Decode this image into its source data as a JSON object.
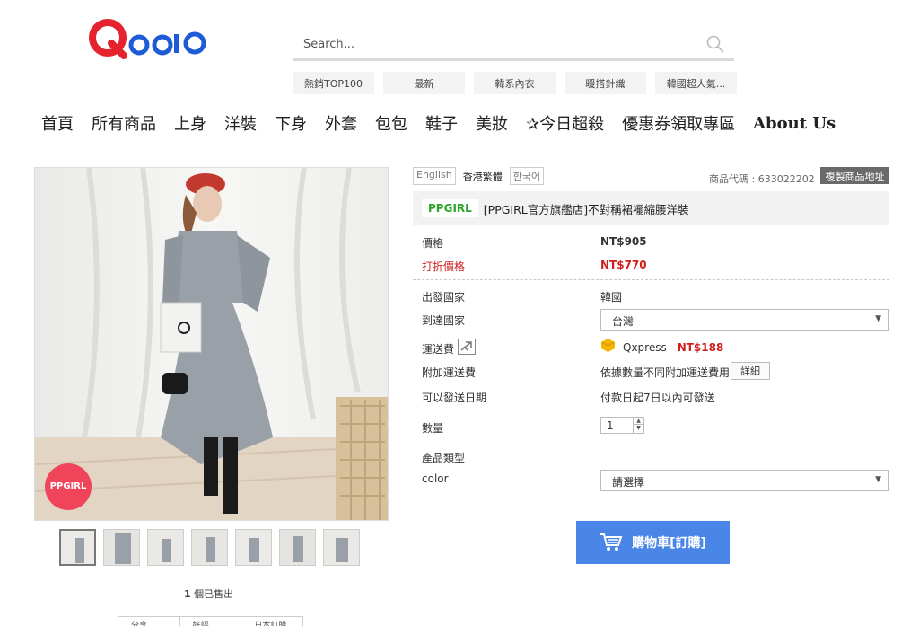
{
  "header": {
    "logo_text": "Qoo10",
    "search": {
      "placeholder": "Search..."
    },
    "quick_tags": [
      "熱銷TOP100",
      "最新",
      "韓系內衣",
      "暖搭針織",
      "韓國超人氣..."
    ]
  },
  "categories": [
    "首頁",
    "所有商品",
    "上身",
    "洋裝",
    "下身",
    "外套",
    "包包",
    "鞋子",
    "美妝",
    "✰今日超殺",
    "優惠券領取專區",
    "About Us"
  ],
  "gallery": {
    "badge": "PPGIRL",
    "sold_count": "1",
    "sold_suffix": " 個已售出",
    "share_labels": [
      "分享",
      "好評",
      "日本訂購"
    ]
  },
  "product": {
    "languages": [
      "English",
      "香港繁體",
      "한국어"
    ],
    "active_language": "香港繁體",
    "code_text": "商品代碼 : 633022202",
    "copy_label": "複製商品地址",
    "shop": "PPGIRL",
    "title": "[PPGIRL官方旗艦店]不對稱裙襬縮腰洋裝",
    "price_label": "價格",
    "price_value": "NT$905",
    "discount_label": "打折價格",
    "discount_value": "NT$770",
    "origin_label": "出發國家",
    "origin_value": "韓國",
    "dest_label": "到達國家",
    "dest_value": "台灣",
    "shipping_label": "運送費",
    "shipping_method": "Qxpress - ",
    "shipping_price": "NT$188",
    "extra_label": "附加運送費",
    "extra_value": "依據數量不同附加運送費用",
    "detail_label": "詳細",
    "ship_date_label": "可以發送日期",
    "ship_date_value": "付款日起7日以內可發送",
    "qty_label": "數量",
    "qty_value": "1",
    "type_label": "產品類型",
    "color_label": "color",
    "color_value": "請選擇",
    "cart_label": "購物車[訂購]"
  },
  "colors": {
    "accent_blue": "#4a85e8",
    "price_red": "#d01f1f",
    "shop_green": "#2aa52a",
    "logo_red": "#e5222e",
    "logo_blue": "#1e5bd6"
  }
}
